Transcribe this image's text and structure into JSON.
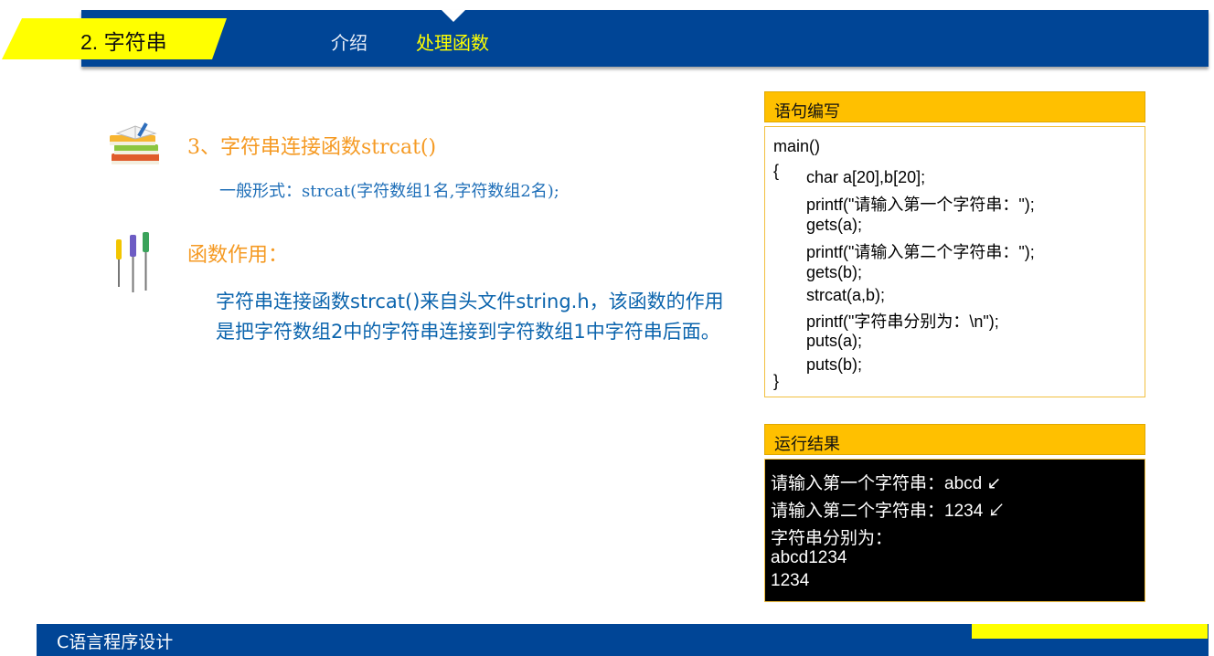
{
  "colors": {
    "brand_blue": "#004596",
    "accent_yellow": "#ffff00",
    "panel_header": "#ffc000",
    "heading_orange": "#f59a23",
    "body_blue": "#0b64ad"
  },
  "header": {
    "chapter": "2. 字符串",
    "nav": [
      {
        "label": "介绍",
        "active": false
      },
      {
        "label": "处理函数",
        "active": true
      }
    ]
  },
  "main": {
    "section_heading": "3、字符串连接函数strcat()",
    "general_form": "一般形式：strcat(字符数组1名,字符数组2名);",
    "function_heading": "函数作用：",
    "description": "字符串连接函数strcat()来自头文件string.h，该函数的作用是把字符数组2中的字符串连接到字符数组1中字符串后面。",
    "icons": [
      "books-icon",
      "screwdrivers-icon"
    ]
  },
  "code_panel": {
    "title": "语句编写",
    "lines": [
      "main()",
      "{",
      "char a[20],b[20];",
      "printf(\"请输入第一个字符串：\");",
      "gets(a);",
      "printf(\"请输入第二个字符串：\");",
      "gets(b);",
      "strcat(a,b);",
      "printf(\"字符串分别为：\\n\");",
      "puts(a);",
      "puts(b);",
      "}"
    ]
  },
  "result_panel": {
    "title": "运行结果",
    "lines": [
      "请输入第一个字符串：abcd ↙",
      "请输入第二个字符串：1234 ↙",
      "字符串分别为：",
      "abcd1234",
      "1234"
    ]
  },
  "footer": {
    "title": "C语言程序设计"
  }
}
